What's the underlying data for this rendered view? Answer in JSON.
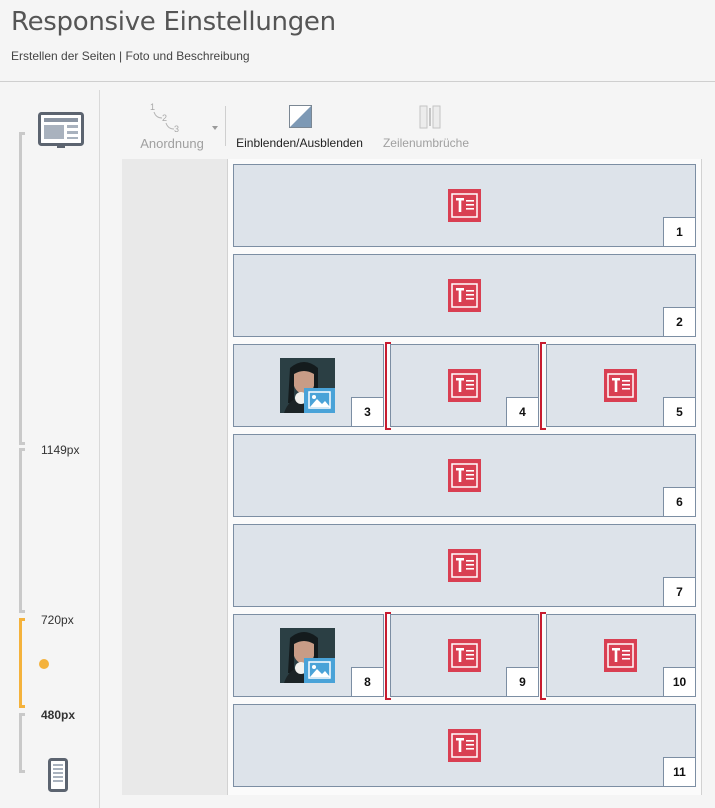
{
  "page": {
    "title": "Responsive Einstellungen",
    "subtitle": "Erstellen der Seiten | Foto und Beschreibung"
  },
  "breakpoints": [
    {
      "label": "1149px"
    },
    {
      "label": "720px",
      "active": true
    },
    {
      "label": "480px"
    }
  ],
  "toolbar": {
    "arrange": {
      "label": "Anordnung"
    },
    "toggle": {
      "label": "Einblenden/Ausblenden"
    },
    "linebreaks": {
      "label": "Zeilenumbrüche"
    }
  },
  "cells": {
    "c1": "1",
    "c2": "2",
    "c3": "3",
    "c4": "4",
    "c5": "5",
    "c6": "6",
    "c7": "7",
    "c8": "8",
    "c9": "9",
    "c10": "10",
    "c11": "11"
  },
  "icons": {
    "desktop": "desktop-icon",
    "phone": "phone-icon",
    "text": "text-block-icon",
    "image": "image-icon",
    "arrange": "numbered-order-icon",
    "toggle": "show-hide-icon",
    "linebreak": "line-break-icon"
  },
  "colors": {
    "accent": "#f4b23c",
    "text_icon": "#d93f52",
    "image_badge": "#4aa3d8",
    "cell": "#dde3ea",
    "bracket": "#c71b2f"
  }
}
